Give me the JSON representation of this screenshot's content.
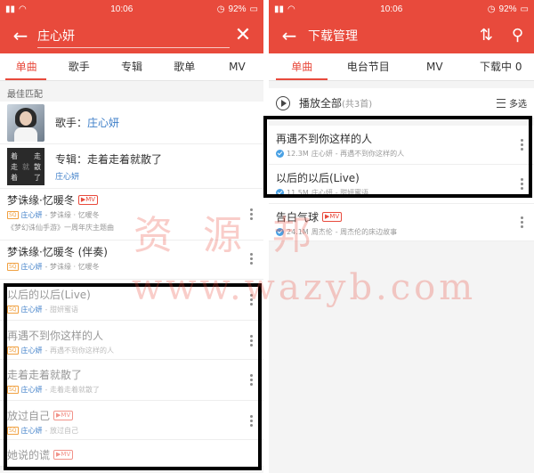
{
  "status": {
    "time": "10:06",
    "battery": "92%"
  },
  "left": {
    "search_query": "庄心妍",
    "tabs": [
      "单曲",
      "歌手",
      "专辑",
      "歌单",
      "MV"
    ],
    "best_match_label": "最佳匹配",
    "artist": {
      "prefix": "歌手：",
      "name": "庄心妍"
    },
    "album": {
      "prefix": "专辑：",
      "name": "走着走着就散了",
      "artist": "庄心妍",
      "cover_text": [
        "走",
        "散",
        "了",
        "着",
        "走",
        "着",
        "就"
      ]
    },
    "songs": [
      {
        "title": "梦诛缘·忆暖冬",
        "mv": "MV",
        "artist": "庄心妍",
        "detail": " - 梦诛缘 · 忆暖冬",
        "extra": "《梦幻诛仙手游》一周年庆主题曲"
      },
      {
        "title": "梦诛缘·忆暖冬 (伴奏)",
        "mv": "",
        "artist": "庄心妍",
        "detail": " - 梦诛缘 · 忆暖冬",
        "extra": ""
      },
      {
        "title": "以后的以后(Live)",
        "mv": "",
        "artist": "庄心妍",
        "detail": " - 甜妍蜜语",
        "extra": ""
      },
      {
        "title": "再遇不到你这样的人",
        "mv": "",
        "artist": "庄心妍",
        "detail": " - 再遇不到你这样的人",
        "extra": ""
      },
      {
        "title": "走着走着就散了",
        "mv": "",
        "artist": "庄心妍",
        "detail": " - 走着走着就散了",
        "extra": ""
      },
      {
        "title": "放过自己",
        "mv": "MV",
        "artist": "庄心妍",
        "detail": " - 放过自己",
        "extra": ""
      },
      {
        "title": "她说的谎",
        "mv": "MV",
        "artist": "",
        "detail": "",
        "extra": ""
      }
    ],
    "sq_badge": "SQ"
  },
  "right": {
    "title": "下载管理",
    "tabs": [
      "单曲",
      "电台节目",
      "MV",
      "下载中 0"
    ],
    "play_all": "播放全部",
    "play_count": "(共3首)",
    "multi_select": "多选",
    "songs": [
      {
        "title": "再遇不到你这样的人",
        "mv": "",
        "size": "12.3M",
        "artist": "庄心妍",
        "detail": " - 再遇不到你这样的人"
      },
      {
        "title": "以后的以后(Live)",
        "mv": "",
        "size": "11.5M",
        "artist": "庄心妍",
        "detail": " - 甜妍蜜语"
      },
      {
        "title": "告白气球",
        "mv": "MV",
        "size": "24.1M",
        "artist": "周杰伦",
        "detail": " - 周杰伦的床边故事"
      }
    ]
  },
  "watermark": {
    "line1": "资源邦",
    "line2": "www.wazyb.com"
  },
  "colors": {
    "accent": "#e84a3c",
    "link": "#3d7ec8"
  }
}
